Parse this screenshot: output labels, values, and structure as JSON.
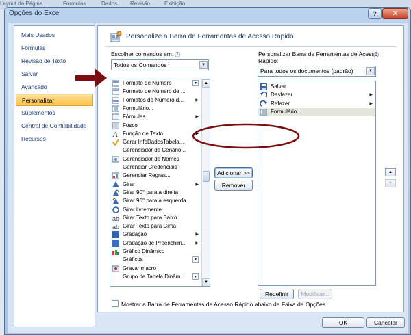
{
  "background": {
    "strip_texts": [
      "Layout da Página",
      "Fórmulas",
      "Dados",
      "Revisão",
      "Exibição"
    ]
  },
  "window": {
    "title": "Opções do Excel",
    "help_label": "?",
    "close_label": "✕"
  },
  "nav": {
    "items": [
      {
        "label": "Mais Usados",
        "selected": false
      },
      {
        "label": "Fórmulas",
        "selected": false
      },
      {
        "label": "Revisão de Texto",
        "selected": false
      },
      {
        "label": "Salvar",
        "selected": false
      },
      {
        "label": "Avançado",
        "selected": false
      },
      {
        "label": "Personalizar",
        "selected": true
      },
      {
        "label": "Suplementos",
        "selected": false
      },
      {
        "label": "Central de Confiabilidade",
        "selected": false
      },
      {
        "label": "Recursos",
        "selected": false
      }
    ]
  },
  "main": {
    "header_title": "Personalize a Barra de Ferramentas de Acesso Rápido.",
    "choose_label": "Escolher comandos em:",
    "choose_value": "Todos os Comandos",
    "customize_label_line1": "Personalizar Barra de Ferramentas de Acesso",
    "customize_label_line2": "Rápido:",
    "customize_value": "Para todos os documentos (padrão)",
    "info_glyph": "i",
    "commands": [
      {
        "label": "Formato de Número",
        "icon": "number-format-icon",
        "sub": "combo"
      },
      {
        "label": "Formato de Número de ...",
        "icon": "number-format-icon",
        "sub": ""
      },
      {
        "label": "Formatos de Número d...",
        "icon": "number-formats-icon",
        "sub": "arrow"
      },
      {
        "label": "Formulário...",
        "icon": "form-icon",
        "sub": ""
      },
      {
        "label": "Fórmulas",
        "icon": "formulas-icon",
        "sub": "arrow"
      },
      {
        "label": "Fosco",
        "icon": "matte-icon",
        "sub": ""
      },
      {
        "label": "Função de Texto",
        "icon": "text-function-icon",
        "sub": "arrow"
      },
      {
        "label": "Gerar InfoDadosTabela...",
        "icon": "checkmark-icon",
        "sub": ""
      },
      {
        "label": "Gerenciador de Cenário...",
        "icon": "",
        "sub": ""
      },
      {
        "label": "Gerenciador de Nomes",
        "icon": "name-manager-icon",
        "sub": ""
      },
      {
        "label": "Gerenciar Credenciais",
        "icon": "",
        "sub": ""
      },
      {
        "label": "Gerenciar Regras...",
        "icon": "manage-rules-icon",
        "sub": ""
      },
      {
        "label": "Girar",
        "icon": "rotate-icon",
        "sub": "arrow"
      },
      {
        "label": "Girar 90° para a direita",
        "icon": "rotate-right-icon",
        "sub": ""
      },
      {
        "label": "Girar 90° para a esquerda",
        "icon": "rotate-left-icon",
        "sub": ""
      },
      {
        "label": "Girar livremente",
        "icon": "free-rotate-icon",
        "sub": ""
      },
      {
        "label": "Girar Texto para Baixo",
        "icon": "rotate-text-down-icon",
        "sub": ""
      },
      {
        "label": "Girar Texto para Cima",
        "icon": "rotate-text-up-icon",
        "sub": ""
      },
      {
        "label": "Gradação",
        "icon": "gradient-icon",
        "sub": "arrow"
      },
      {
        "label": "Gradação de Preenchim...",
        "icon": "fill-gradient-icon",
        "sub": "arrow"
      },
      {
        "label": "Gráfico Dinâmico",
        "icon": "pivot-chart-icon",
        "sub": ""
      },
      {
        "label": "Gráficos",
        "icon": "",
        "sub": "combo"
      },
      {
        "label": "Gravar macro",
        "icon": "record-macro-icon",
        "sub": ""
      },
      {
        "label": "Grupo de Tabela Dinâm...",
        "icon": "",
        "sub": "combo"
      }
    ],
    "toolbar_items": [
      {
        "label": "Salvar",
        "icon": "save-icon",
        "sub": ""
      },
      {
        "label": "Desfazer",
        "icon": "undo-icon",
        "sub": "arrow"
      },
      {
        "label": "Refazer",
        "icon": "redo-icon",
        "sub": "arrow"
      },
      {
        "label": "Formulário...",
        "icon": "form-icon",
        "sub": ""
      }
    ],
    "add_label": "Adicionar >>",
    "remove_label": "Remover",
    "reset_label": "Redefinir",
    "modify_label": "Modificar...",
    "checkbox_label": "Mostrar a Barra de Ferramentas de Acesso Rápido abaixo da Faixa de Opções",
    "checkbox_checked": false
  },
  "footer": {
    "ok_label": "OK",
    "cancel_label": "Cancelar"
  },
  "colors": {
    "annotation": "#7a0e10",
    "selected_nav": "#ffc14a",
    "window_frame": "#a9c4e6"
  }
}
